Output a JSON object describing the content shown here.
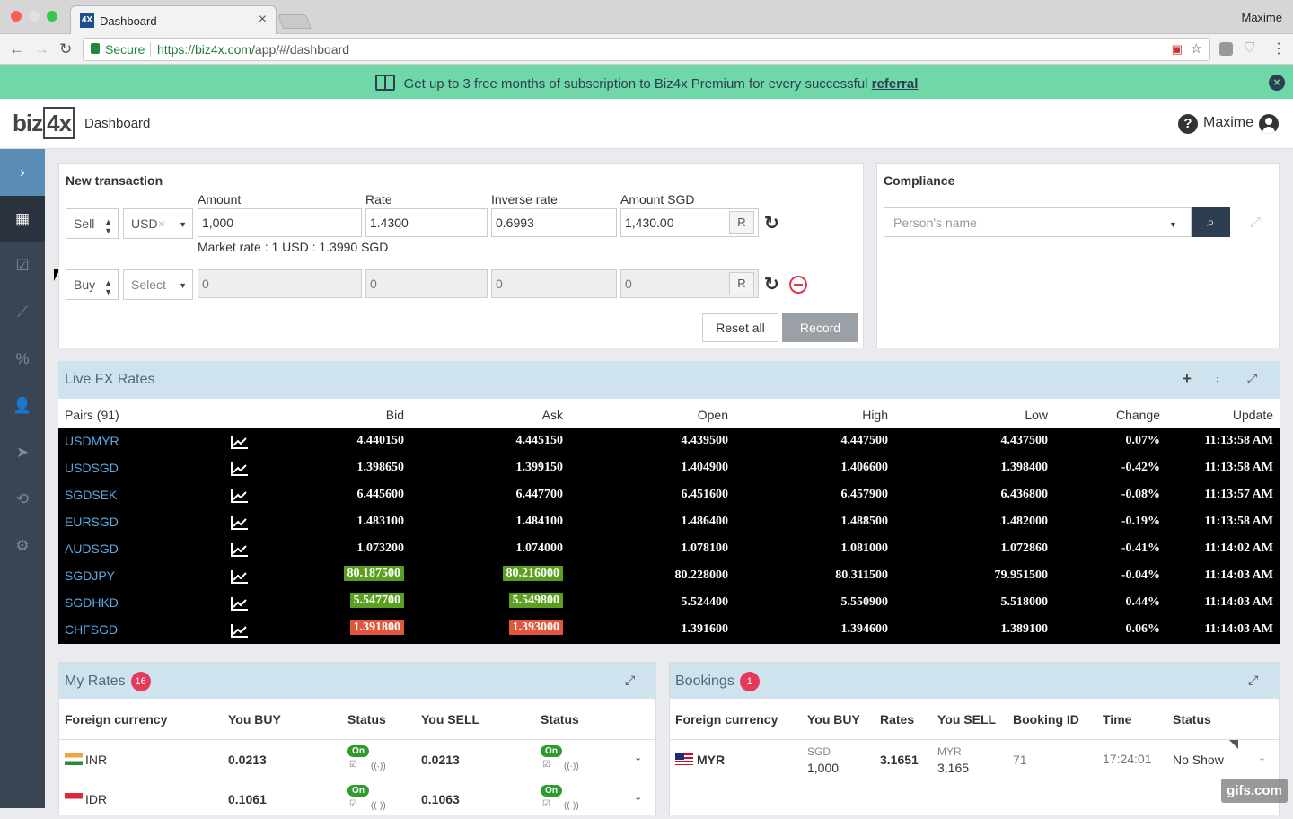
{
  "browser": {
    "tab_title": "Dashboard",
    "tab_favicon": "4X",
    "user": "Maxime",
    "secure_label": "Secure",
    "url_host": "https://biz4x.com",
    "url_path": "/app/#/dashboard"
  },
  "banner": {
    "text": "Get up to 3 free months of subscription to Biz4x Premium for every successful",
    "link": "referral"
  },
  "header": {
    "logo_a": "biz",
    "logo_b": "4x",
    "title": "Dashboard",
    "help": "?",
    "user": "Maxime"
  },
  "sidebar": {
    "items": [
      "expand-icon",
      "dashboard-icon",
      "checklist-icon",
      "chart-icon",
      "percent-icon",
      "user-check-icon",
      "send-icon",
      "sync-icon",
      "settings-icon"
    ]
  },
  "new_transaction": {
    "title": "New transaction",
    "labels": {
      "amount": "Amount",
      "rate": "Rate",
      "inverse": "Inverse rate",
      "amount_sgd": "Amount SGD"
    },
    "row1": {
      "side": "Sell",
      "currency": "USD",
      "amount": "1,000",
      "rate": "1.4300",
      "inverse": "0.6993",
      "amount_sgd": "1,430.00",
      "r": "R"
    },
    "market_rate": "Market rate : 1 USD : 1.3990 SGD",
    "row2": {
      "side": "Buy",
      "currency": "Select",
      "amount": "0",
      "rate": "0",
      "inverse": "0",
      "amount_sgd": "0",
      "r": "R"
    },
    "reset_label": "Reset all",
    "record_label": "Record"
  },
  "compliance": {
    "title": "Compliance",
    "placeholder": "Person's name"
  },
  "fx": {
    "title": "Live FX Rates",
    "columns": {
      "pairs": "Pairs (91)",
      "bid": "Bid",
      "ask": "Ask",
      "open": "Open",
      "high": "High",
      "low": "Low",
      "change": "Change",
      "update": "Update"
    },
    "rows": [
      {
        "pair": "USDMYR",
        "bid": "4.440150",
        "ask": "4.445150",
        "open": "4.439500",
        "high": "4.447500",
        "low": "4.437500",
        "change": "0.07%",
        "update": "11:13:58 AM"
      },
      {
        "pair": "USDSGD",
        "bid": "1.398650",
        "ask": "1.399150",
        "open": "1.404900",
        "high": "1.406600",
        "low": "1.398400",
        "change": "-0.42%",
        "update": "11:13:58 AM"
      },
      {
        "pair": "SGDSEK",
        "bid": "6.445600",
        "ask": "6.447700",
        "open": "6.451600",
        "high": "6.457900",
        "low": "6.436800",
        "change": "-0.08%",
        "update": "11:13:57 AM"
      },
      {
        "pair": "EURSGD",
        "bid": "1.483100",
        "ask": "1.484100",
        "open": "1.486400",
        "high": "1.488500",
        "low": "1.482000",
        "change": "-0.19%",
        "update": "11:13:58 AM"
      },
      {
        "pair": "AUDSGD",
        "bid": "1.073200",
        "ask": "1.074000",
        "open": "1.078100",
        "high": "1.081000",
        "low": "1.072860",
        "change": "-0.41%",
        "update": "11:14:02 AM"
      },
      {
        "pair": "SGDJPY",
        "bid": "80.187500",
        "ask": "80.216000",
        "open": "80.228000",
        "high": "80.311500",
        "low": "79.951500",
        "change": "-0.04%",
        "update": "11:14:03 AM"
      },
      {
        "pair": "SGDHKD",
        "bid": "5.547700",
        "ask": "5.549800",
        "open": "5.524400",
        "high": "5.550900",
        "low": "5.518000",
        "change": "0.44%",
        "update": "11:14:03 AM"
      },
      {
        "pair": "CHFSGD",
        "bid": "1.391800",
        "ask": "1.393000",
        "open": "1.391600",
        "high": "1.394600",
        "low": "1.389100",
        "change": "0.06%",
        "update": "11:14:03 AM"
      }
    ],
    "highlight_colors": {
      "up": "#5a9f1f",
      "down": "#e0573c"
    }
  },
  "my_rates": {
    "title": "My Rates",
    "count": "16",
    "columns": {
      "currency": "Foreign currency",
      "buy": "You BUY",
      "status": "Status",
      "sell": "You SELL",
      "status2": "Status"
    },
    "rows": [
      {
        "currency": "INR",
        "buy": "0.0213",
        "status": "On",
        "sell": "0.0213",
        "status2": "On"
      },
      {
        "currency": "IDR",
        "buy": "0.1061",
        "status": "On",
        "sell": "0.1063",
        "status2": "On"
      }
    ]
  },
  "bookings": {
    "title": "Bookings",
    "count": "1",
    "columns": {
      "currency": "Foreign currency",
      "buy": "You BUY",
      "rates": "Rates",
      "sell": "You SELL",
      "id": "Booking ID",
      "time": "Time",
      "status": "Status"
    },
    "row": {
      "currency": "MYR",
      "buy_ccy": "SGD",
      "buy_amt": "1,000",
      "rate": "3.1651",
      "sell_ccy": "MYR",
      "sell_amt": "3,165",
      "id": "71",
      "time": "17:24:01",
      "status": "No Show"
    }
  },
  "watermark": "gifs.com"
}
